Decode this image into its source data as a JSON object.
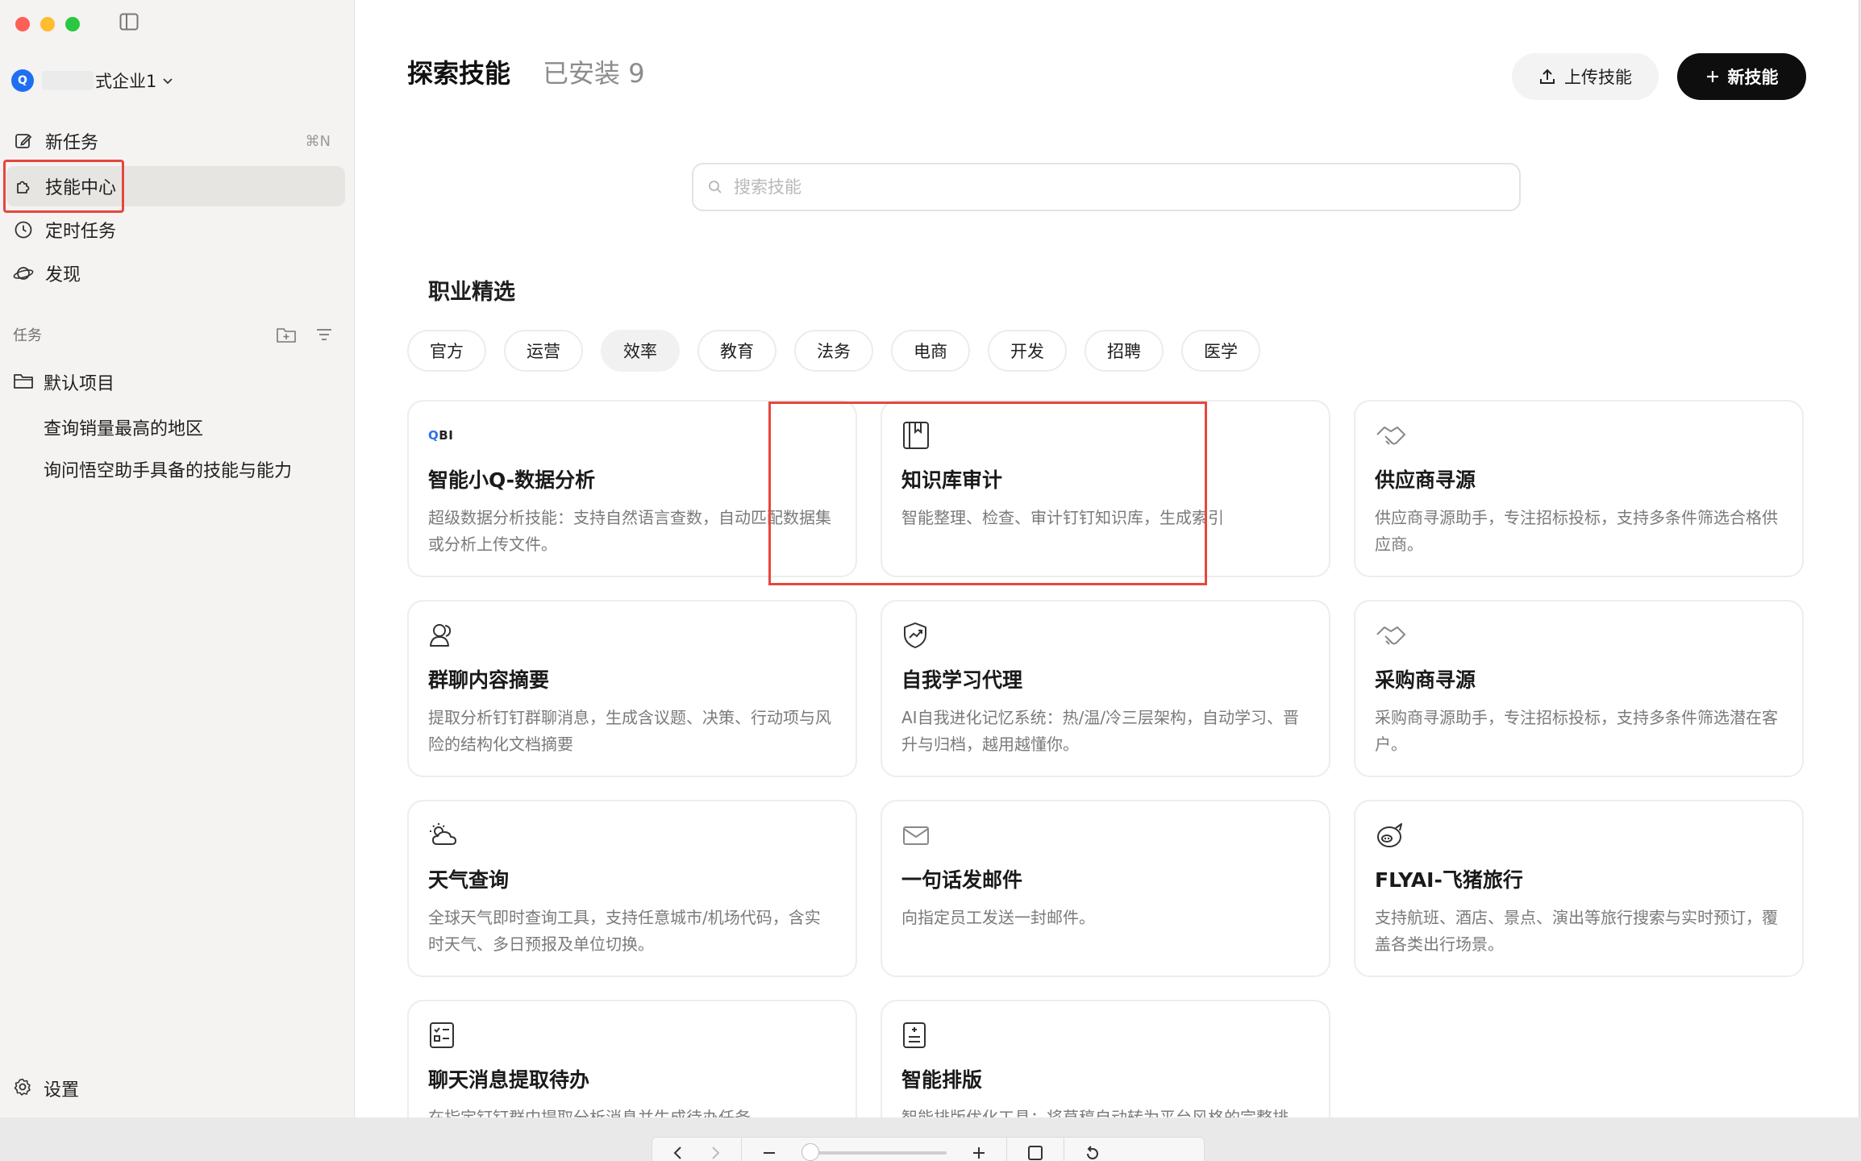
{
  "sidebar": {
    "org_avatar": "Q",
    "org_name": "式企业1",
    "nav": [
      {
        "label": "新任务",
        "shortcut": "⌘N"
      },
      {
        "label": "技能中心"
      },
      {
        "label": "定时任务"
      },
      {
        "label": "发现"
      }
    ],
    "tasks_section_title": "任务",
    "project_name": "默认项目",
    "tasks": [
      "查询销量最高的地区",
      "询问悟空助手具备的技能与能力"
    ],
    "settings_label": "设置"
  },
  "main": {
    "tabs": [
      {
        "label": "探索技能",
        "active": true
      },
      {
        "label": "已安装 9",
        "active": false
      }
    ],
    "upload_button": "上传技能",
    "new_button": "新技能",
    "search_placeholder": "搜索技能",
    "category_title": "职业精选",
    "chips": [
      {
        "label": "官方"
      },
      {
        "label": "运营"
      },
      {
        "label": "效率",
        "active": true
      },
      {
        "label": "教育"
      },
      {
        "label": "法务"
      },
      {
        "label": "电商"
      },
      {
        "label": "开发"
      },
      {
        "label": "招聘"
      },
      {
        "label": "医学"
      }
    ],
    "cards": [
      {
        "icon": "qbi-logo",
        "title": "智能小Q-数据分析",
        "desc": "超级数据分析技能：支持自然语言查数，自动匹配数据集或分析上传文件。"
      },
      {
        "icon": "book-icon",
        "title": "知识库审计",
        "desc": "智能整理、检查、审计钉钉知识库，生成索引"
      },
      {
        "icon": "handshake-icon",
        "title": "供应商寻源",
        "desc": "供应商寻源助手，专注招标投标，支持多条件筛选合格供应商。"
      },
      {
        "icon": "group-chat-icon",
        "title": "群聊内容摘要",
        "desc": "提取分析钉钉群聊消息，生成含议题、决策、行动项与风险的结构化文档摘要"
      },
      {
        "icon": "shield-growth-icon",
        "title": "自我学习代理",
        "desc": "AI自我进化记忆系统：热/温/冷三层架构，自动学习、晋升与归档，越用越懂你。"
      },
      {
        "icon": "handshake-icon",
        "title": "采购商寻源",
        "desc": "采购商寻源助手，专注招标投标，支持多条件筛选潜在客户。"
      },
      {
        "icon": "weather-icon",
        "title": "天气查询",
        "desc": "全球天气即时查询工具，支持任意城市/机场代码，含实时天气、多日预报及单位切换。"
      },
      {
        "icon": "mail-icon",
        "title": "一句话发邮件",
        "desc": "向指定员工发送一封邮件。"
      },
      {
        "icon": "pig-icon",
        "title": "FLYAI-飞猪旅行",
        "desc": "支持航班、酒店、景点、演出等旅行搜索与实时预订，覆盖各类出行场景。"
      },
      {
        "icon": "checklist-icon",
        "title": "聊天消息提取待办",
        "desc": "在指定钉钉群中提取分析消息并生成待办任务。"
      },
      {
        "icon": "document-icon",
        "title": "智能排版",
        "desc": "智能排版优化工具：将草稿自动转为平台风格的完整排版。"
      }
    ]
  }
}
